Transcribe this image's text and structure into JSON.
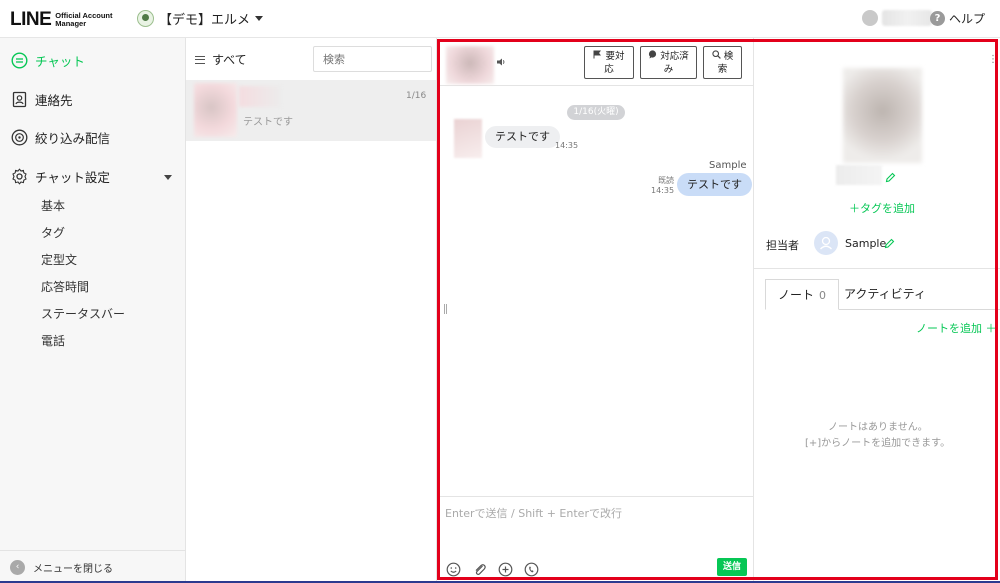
{
  "header": {
    "logo_main": "LINE",
    "logo_sub_1": "Official Account",
    "logo_sub_2": "Manager",
    "account_name": "【デモ】エルメ",
    "help_label": "ヘルプ"
  },
  "sidebar": {
    "items": [
      {
        "label": "チャット",
        "icon": "chat-bubble-icon",
        "active": true
      },
      {
        "label": "連絡先",
        "icon": "contacts-icon"
      },
      {
        "label": "絞り込み配信",
        "icon": "broadcast-icon"
      },
      {
        "label": "チャット設定",
        "icon": "gear-icon"
      }
    ],
    "sub_items": [
      "基本",
      "タグ",
      "定型文",
      "応答時間",
      "ステータスバー",
      "電話"
    ],
    "close_menu_label": "メニューを閉じる"
  },
  "chat_list": {
    "filter_label": "すべて",
    "search_placeholder": "検索",
    "rows": [
      {
        "preview": "テストです",
        "date": "1/16"
      }
    ]
  },
  "chat": {
    "buttons": [
      {
        "icon": "flag-icon",
        "line1": "要対",
        "line2": "応"
      },
      {
        "icon": "speech-icon",
        "line1": "対応済",
        "line2": "み"
      },
      {
        "icon": "search-icon",
        "line1": "検",
        "line2": "索"
      }
    ],
    "date_chip": "1/16(火曜)",
    "messages": [
      {
        "direction": "in",
        "text": "テストです",
        "time": "14:35"
      },
      {
        "direction": "out",
        "sender": "Sample",
        "text": "テストです",
        "read": "既読",
        "time": "14:35"
      }
    ],
    "composer_placeholder": "Enterで送信 / Shift + Enterで改行",
    "send_label": "送信"
  },
  "profile": {
    "add_tag_label": "＋タグを追加",
    "owner_label": "担当者",
    "owner_name": "Sample",
    "tabs": [
      {
        "label": "ノート",
        "count": "0"
      },
      {
        "label": "アクティビティ"
      }
    ],
    "add_note_label": "ノートを追加 ＋",
    "empty_line1": "ノートはありません。",
    "empty_line2": "[+]からノートを追加できます。"
  },
  "colors": {
    "accent": "#06c755",
    "highlight_border": "#e3001b",
    "outgoing_bubble": "#c9dcf7"
  }
}
